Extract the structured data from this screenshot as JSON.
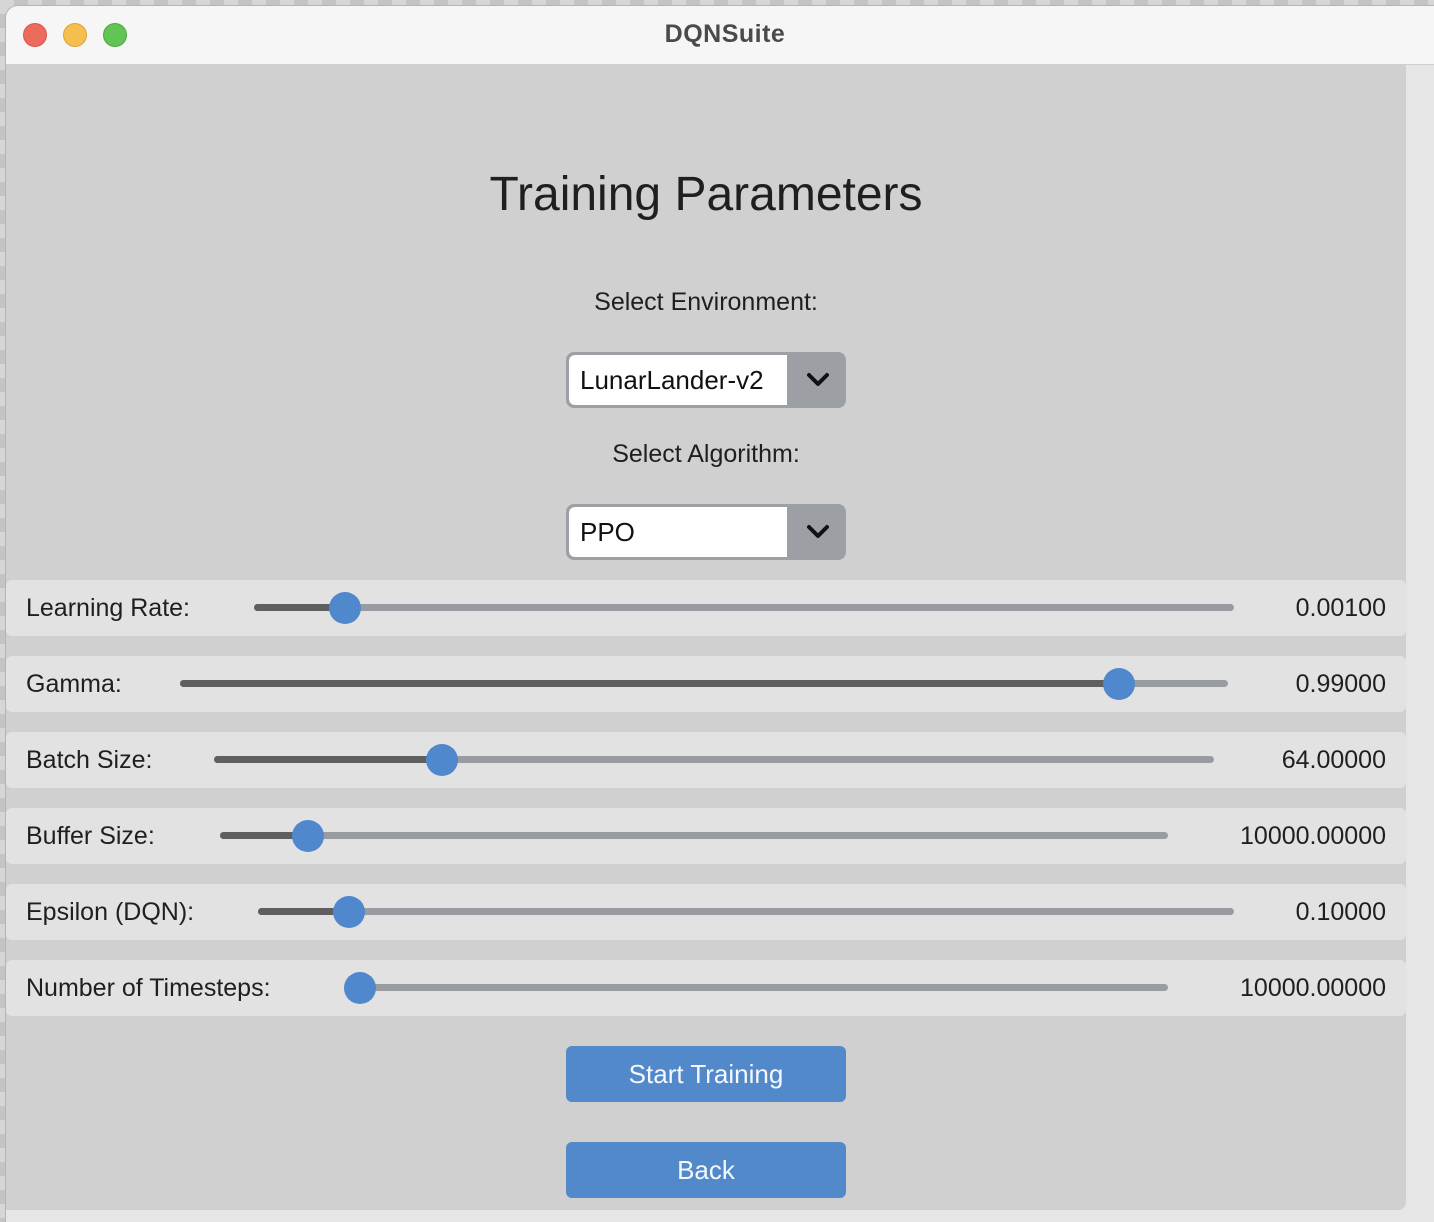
{
  "window": {
    "title": "DQNSuite"
  },
  "page": {
    "heading": "Training Parameters",
    "environment": {
      "label": "Select Environment:",
      "selected": "LunarLander-v2"
    },
    "algorithm": {
      "label": "Select Algorithm:",
      "selected": "PPO"
    },
    "sliders": [
      {
        "label": "Learning Rate:",
        "value_text": "0.00100",
        "level": 0.093
      },
      {
        "label": "Gamma:",
        "value_text": "0.99000",
        "level": 0.896
      },
      {
        "label": "Batch Size:",
        "value_text": "64.00000",
        "level": 0.228
      },
      {
        "label": "Buffer Size:",
        "value_text": "10000.00000",
        "level": 0.093
      },
      {
        "label": "Epsilon (DQN):",
        "value_text": "0.10000",
        "level": 0.093
      },
      {
        "label": "Number of Timesteps:",
        "value_text": "10000.00000",
        "level": 0.0
      }
    ],
    "buttons": {
      "start": "Start Training",
      "back": "Back"
    }
  },
  "colors": {
    "accent": "#4f88cc",
    "button": "#5289cb",
    "track": "#989ca1",
    "track_fill": "#5f5f5f",
    "content_bg": "#d0d0d0",
    "row_bg": "#e2e2e2"
  },
  "icons": {
    "close": "close-icon",
    "minimize": "minimize-icon",
    "maximize": "maximize-icon",
    "dropdown": "chevron-down-icon"
  }
}
